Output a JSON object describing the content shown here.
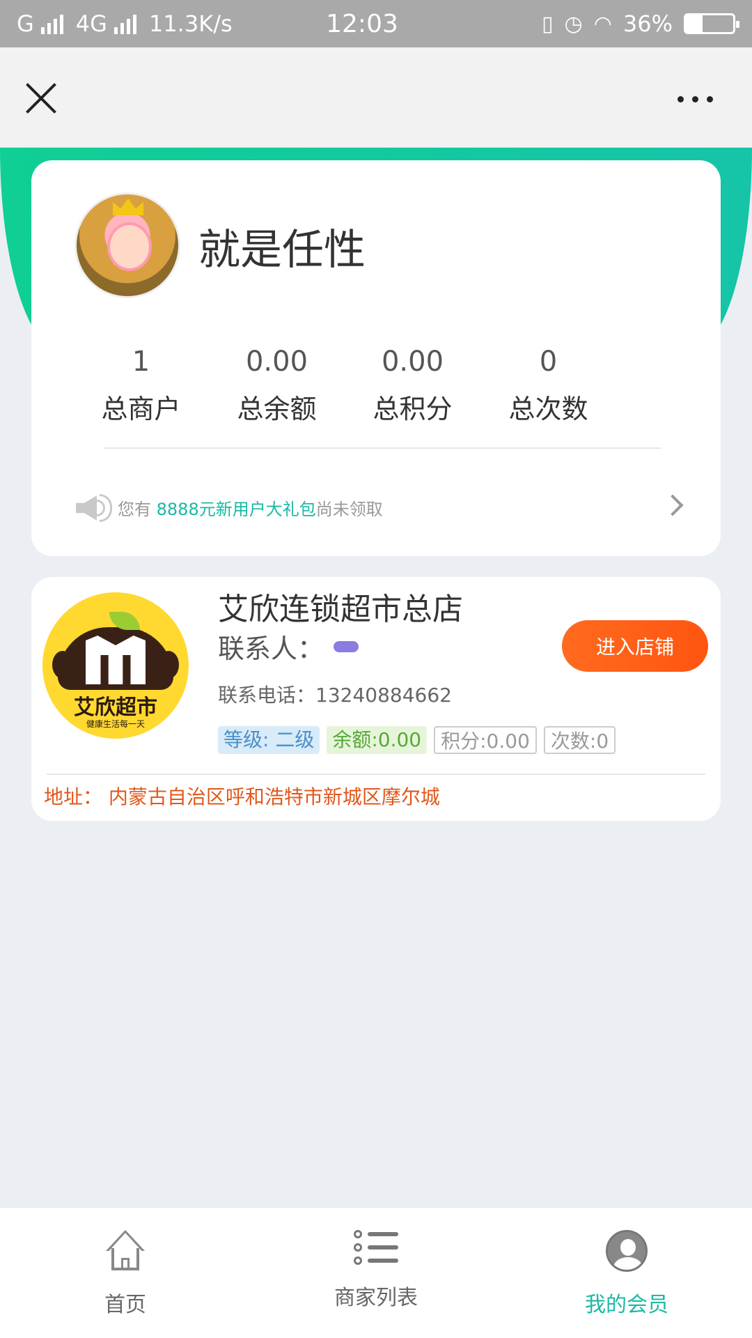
{
  "status_bar": {
    "carrier1": "G",
    "carrier2": "4G",
    "net_speed": "11.3K/s",
    "time": "12:03",
    "battery": "36%",
    "icons": [
      "signal-icon",
      "vibrate-icon",
      "alarm-icon",
      "wifi-icon",
      "battery-icon"
    ]
  },
  "navbar": {
    "icons": [
      "close-icon",
      "more-icon"
    ]
  },
  "profile": {
    "username": "就是任性",
    "stats": [
      {
        "value": "1",
        "label": "总商户"
      },
      {
        "value": "0.00",
        "label": "总余额"
      },
      {
        "value": "0.00",
        "label": "总积分"
      },
      {
        "value": "0",
        "label": "总次数"
      }
    ],
    "notice": {
      "prefix": "您有 ",
      "highlight": "8888元新用户大礼包",
      "suffix": "尚未领取"
    }
  },
  "shop": {
    "logo_brand": "艾欣超市",
    "logo_slogan": "健康生活每一天",
    "name": "艾欣连锁超市总店",
    "contact_label": "联系人：",
    "phone": "联系电话：13240884662",
    "tags": {
      "level": "等级: 二级",
      "balance": "余额:0.00",
      "points": "积分:0.00",
      "count": "次数:0"
    },
    "enter_button": "进入店铺",
    "address": "地址：  内蒙古自治区呼和浩特市新城区摩尔城"
  },
  "tabbar": {
    "items": [
      {
        "label": "首页",
        "icon": "home-icon",
        "active": false
      },
      {
        "label": "商家列表",
        "icon": "list-icon",
        "active": false
      },
      {
        "label": "我的会员",
        "icon": "member-icon",
        "active": true
      }
    ]
  },
  "colors": {
    "accent": "#1fb8a5",
    "header_green": "#12c9a0",
    "button_orange": "#ff5f16",
    "address_orange": "#e2571a"
  }
}
